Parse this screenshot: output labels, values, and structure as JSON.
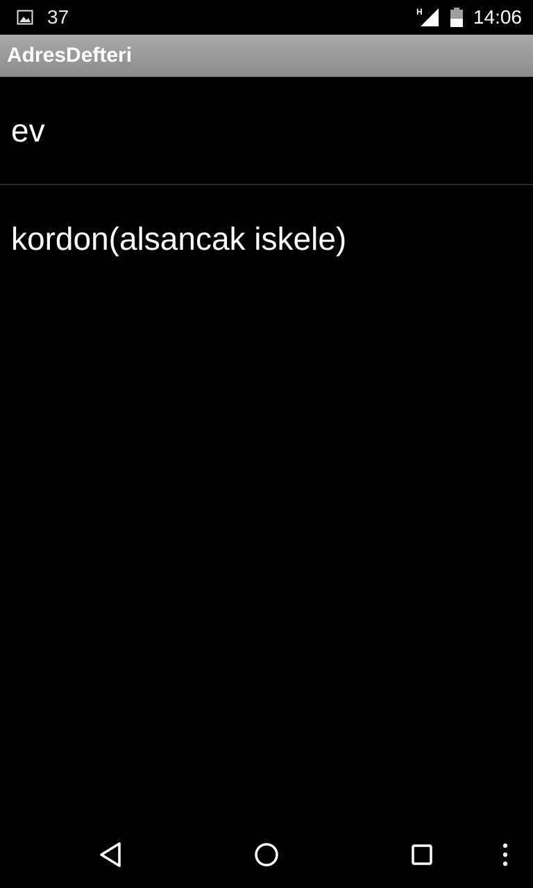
{
  "status_bar": {
    "notification_icon": "gallery-icon",
    "notification_count": "37",
    "signal_icon": "signal-h-icon",
    "network_type": "H",
    "battery_icon": "battery-icon",
    "time": "14:06"
  },
  "action_bar": {
    "title": "AdresDefteri"
  },
  "list": {
    "items": [
      {
        "label": "ev"
      },
      {
        "label": "kordon(alsancak iskele)"
      }
    ]
  },
  "nav_bar": {
    "back_icon": "back-icon",
    "home_icon": "home-icon",
    "recents_icon": "recents-icon",
    "menu_icon": "overflow-menu-icon"
  },
  "colors": {
    "background": "#000000",
    "action_bar": "#9a9a9a",
    "text": "#ffffff",
    "divider": "#2a2a2a"
  }
}
